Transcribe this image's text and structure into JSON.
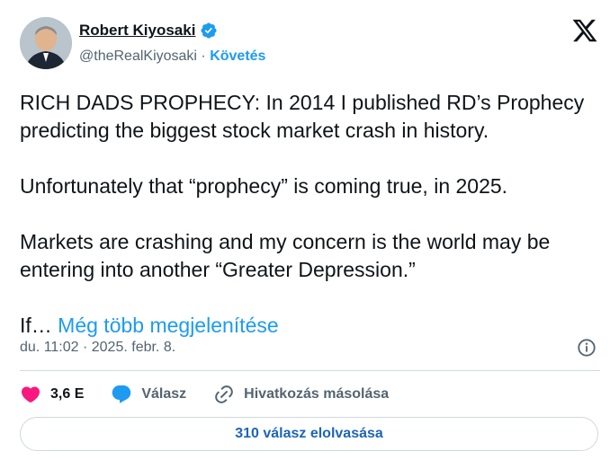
{
  "author": {
    "name": "Robert Kiyosaki",
    "handle": "@theRealKiyosaki",
    "separator": "·",
    "follow_label": "Követés"
  },
  "post": {
    "line1": "RICH DADS PROPHECY: In 2014 I published RD’s Prophecy predicting the biggest stock market crash in history.",
    "line2": "Unfortunately that “prophecy” is coming true, in 2025.",
    "line3": "Markets are crashing and my concern is the world may be entering into another “Greater Depression.”",
    "truncated": "If…",
    "show_more": "Még több megjelenítése"
  },
  "timestamp": "du. 11:02 · 2025. febr. 8.",
  "actions": {
    "likes": "3,6 E",
    "reply": "Válasz",
    "copy_link": "Hivatkozás másolása"
  },
  "read_replies": "310 válasz elolvasása",
  "icons": {
    "verified": "verified-badge-icon",
    "x_logo": "x-logo-icon",
    "info": "info-icon",
    "like": "heart-icon",
    "reply": "speech-bubble-icon",
    "link": "link-icon"
  },
  "colors": {
    "accent": "#1d9bf0",
    "heart": "#f91880",
    "text": "#0f1419",
    "muted": "#536471",
    "border": "#cfd9de"
  }
}
